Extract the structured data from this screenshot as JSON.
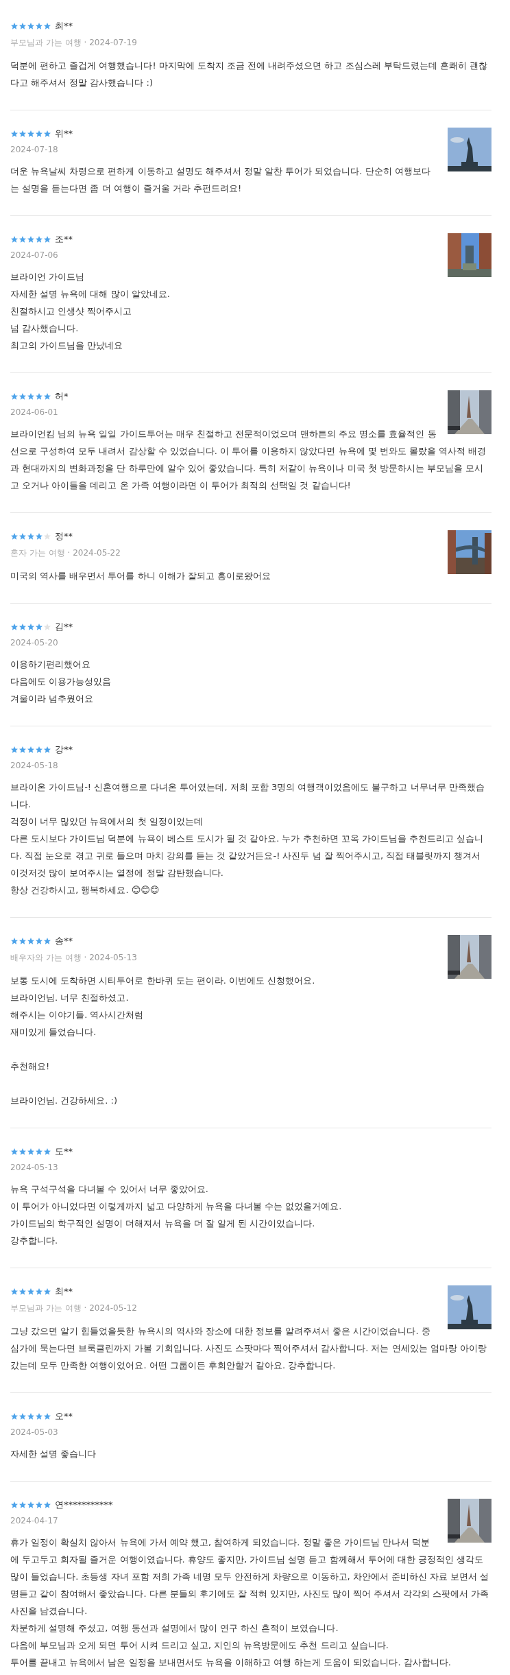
{
  "reviews": [
    {
      "stars": 5,
      "name": "최**",
      "trip_type": "부모님과 가는 여행",
      "separator": "·",
      "date": "2024-07-19",
      "lines": [
        {
          "text": "덕분에 편하고 즐겁게 여행했습니다! 마지막에 도착지 조금 전에 내려주셨으면 하고 조심스레 부탁드렸는데 흔쾌히 괜찮다고 해주셔서 정말 감사했습니다 :)"
        }
      ]
    },
    {
      "stars": 5,
      "name": "위**",
      "date": "2024-07-18",
      "photo": {
        "kind": "picture"
      },
      "lines": [
        {
          "text": "더운 뉴욕날씨 차령으로 편하게 이동하고 설명도 해주셔서 정말 알찬 투어가 되었습니다. 단순히 여행보다는 설명을 듣는다면 좀 더 여행이 즐거울 거라 추펀드려요!"
        }
      ]
    },
    {
      "stars": 5,
      "name": "조**",
      "date": "2024-07-06",
      "photo": {
        "kind": "picture"
      },
      "lines": [
        {
          "text": "브라이언 가이드님"
        },
        {
          "text": "자세한 설명 뉴욕에 대해 많이 알았네요."
        },
        {
          "text": "친절하시고 인생샷 찍어주시고"
        },
        {
          "text": "넘 감사했습니다."
        },
        {
          "text": "최고의 가이드님을 만났네요"
        }
      ]
    },
    {
      "stars": 5,
      "name": "허*",
      "date": "2024-06-01",
      "photo": {
        "kind": "picture"
      },
      "lines": [
        {
          "text": "브라이언킴 님의 뉴욕 일일 가이드투어는 매우 친절하고 전문적이었으며 맨하튼의 주요 명소를 효율적인 동선으로 구성하여 모두 내려서 감상할 수 있었습니다. 이 투어를 이용하지 않았다면 뉴욕에 몇 번와도 몰랐을 역사적 배경과 현대까지의 변화과정을 단 하루만에 알수 있어 좋았습니다. 특히 저같이 뉴욕이나 미국 첫 방문하시는 부모님을 모시고 오거나 아이들을 데리고 온 가족 여행이라면 이 투어가 최적의 선택일 것 같습니다!"
        }
      ]
    },
    {
      "stars": 4,
      "name": "정**",
      "trip_type": "혼자 가는 여행",
      "separator": "·",
      "date": "2024-05-22",
      "photo": {
        "kind": "picture"
      },
      "lines": [
        {
          "text": "미국의 역사를 배우면서 투어를 하니 이해가 잘되고 흥이로왔어요"
        }
      ]
    },
    {
      "stars": 4,
      "name": "김**",
      "date": "2024-05-20",
      "lines": [
        {
          "text": "이용하기편리했어요"
        },
        {
          "text": "다음에도 이용가능성있음"
        },
        {
          "text": "겨울이라 넘추웠어요"
        }
      ]
    },
    {
      "stars": 5,
      "name": "강**",
      "date": "2024-05-18",
      "lines": [
        {
          "text": "브라이온 가이드님-! 신혼여행으로 다녀온 투어였는데, 저희 포함 3명의 여행객이었음에도 불구하고 너무너무 만족했습니다."
        },
        {
          "text": "걱정이 너무 많았던 뉴욕에서의 첫 일정이었는데"
        },
        {
          "text": "다른 도시보다 가이드님 덕분에 뉴욕이 베스트 도시가 될 것 같아요. 누가 추천하면 꼬옥 가이드님을 추천드리고 싶습니다. 직접 눈으로 겪고 귀로 들으며 마치 강의를 듣는 것 같았거든요-! 사진두 넘 잘 찍어주시고, 직접 태블릿까지 챙겨서 이것저것 많이 보여주시는 열정에 정말 감탄했습니다."
        },
        {
          "text": "항상 건강하시고, 행복하세요. 😊😊😊"
        }
      ]
    },
    {
      "stars": 5,
      "name": "송**",
      "trip_type": "배우자와 가는 여행",
      "separator": "·",
      "date": "2024-05-13",
      "photo": {
        "kind": "picture"
      },
      "paragraphs": [
        {
          "lines": [
            {
              "text": "보통 도시에 도착하면 시티투어로 한바퀴 도는 편이라. 이번에도 신청했어요."
            },
            {
              "text": "브라이언님. 너무 친절하셨고."
            },
            {
              "text": "해주시는 이야기들. 역사시간처럼"
            },
            {
              "text": "재미있게 들었습니다."
            }
          ]
        },
        {
          "lines": [
            {
              "text": "추천해요!"
            }
          ]
        },
        {
          "lines": [
            {
              "text": "브라이언님. 건강하세요. :)"
            }
          ]
        }
      ]
    },
    {
      "stars": 5,
      "name": "도**",
      "date": "2024-05-13",
      "lines": [
        {
          "text": "뉴욕 구석구석을 다녀볼 수 있어서 너무 좋았어요."
        },
        {
          "text": "이 투어가 아니었다면 이렇게까지 넓고 다양하게 뉴욕을 다녀볼 수는 없었을거예요."
        },
        {
          "text": "가이드님의 학구적인 설명이 더해져서 뉴욕을 더 잘 알게 된 시간이었습니다."
        },
        {
          "text": "강추합니다."
        }
      ]
    },
    {
      "stars": 5,
      "name": "최**",
      "trip_type": "부모님과 가는 여행",
      "separator": "·",
      "date": "2024-05-12",
      "photo": {
        "kind": "picture"
      },
      "lines": [
        {
          "text": "그냥 갔으면 알기 힘들었을듯한 뉴욕시의 역사와 장소에 대한 정보를 알려주셔서 좋은 시간이었습니다. 중심가에 묵는다면 브룩클린까지 가볼 기회입니다. 사진도 스팟마다 찍어주셔서 감사합니다. 저는 연세있는 엄마랑 아이랑 갔는데 모두 만족한 여행이었어요. 어떤 그룹이든 후회안할거 같아요. 강추합니다."
        }
      ]
    },
    {
      "stars": 5,
      "name": "오**",
      "date": "2024-05-03",
      "lines": [
        {
          "text": "자세한 설명 좋습니다"
        }
      ]
    },
    {
      "stars": 5,
      "name": "연***********",
      "date": "2024-04-17",
      "photo": {
        "kind": "picture"
      },
      "lines": [
        {
          "text": "휴가 일정이 확실치 않아서 뉴욕에 가서 예약 했고, 참여하게 되었습니다. 정말 좋은 가이드님 만나서 덕분에 두고두고 회자될 즐거운 여행이였습니다. 휴양도 좋지만, 가이드님 설명 듣고 함께해서 투어에 대한 긍정적인 생각도 많이 들었습니다. 초등생 자녀 포함 저희 가족 네명 모두 안전하게 차량으로 이동하고, 차안에서 준비하신 자료 보면서 설명듣고 같이 참여해서 좋았습니다. 다른 분들의 후기에도 잘 적혀 있지만, 사진도 많이 찍어 주셔서 각각의 스팟에서 가족사진을 남겼습니다."
        },
        {
          "text": "차분하게 설명해 주셨고, 여행 동선과 설명에서 많이 연구 하신 흔적이 보였습니다."
        },
        {
          "text": "다음에 부모님과 오게 되면 투어 시켜 드리고 싶고, 지인의 뉴욕방문에도 추천 드리고 싶습니다."
        },
        {
          "text": "투어를 끝내고 뉴욕에서 남은 일정을 보내면서도 뉴욕을 이해하고 여행 하는게 도움이 되었습니다. 감사합니다."
        }
      ]
    }
  ]
}
